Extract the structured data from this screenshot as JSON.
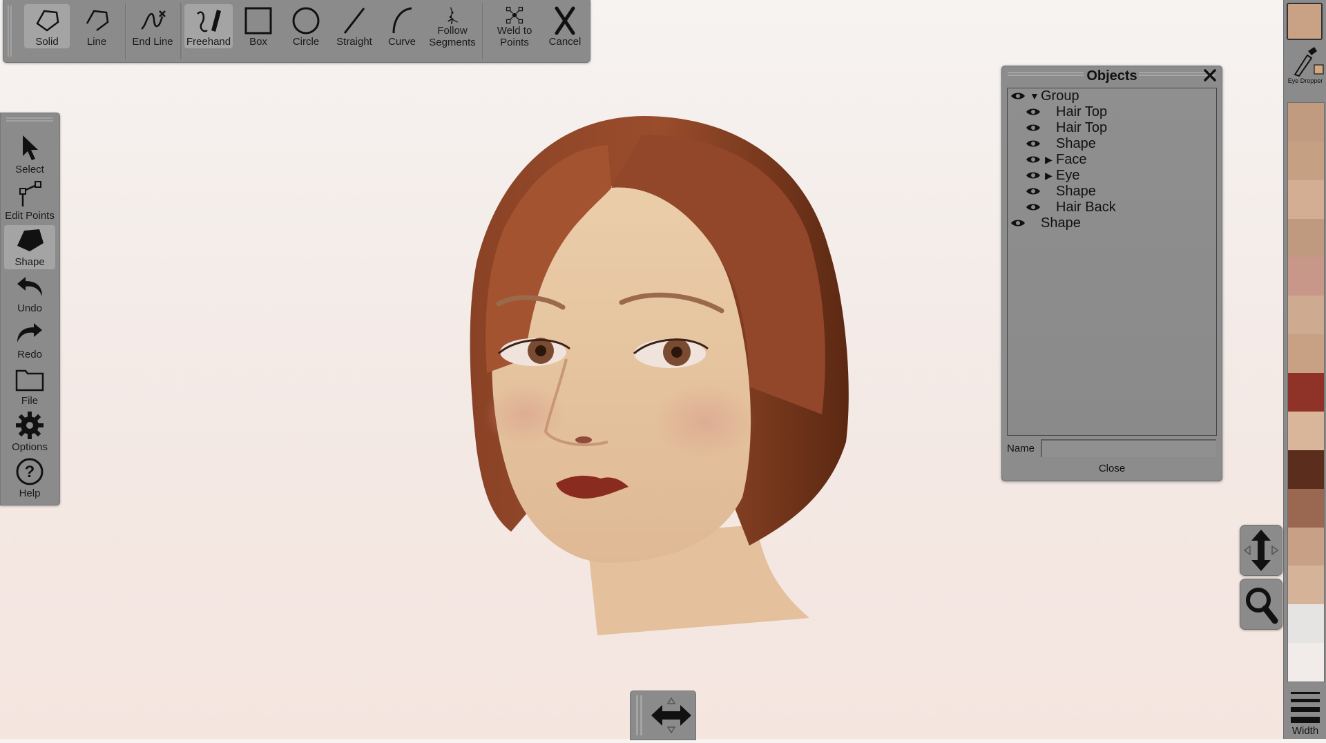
{
  "toolbar": {
    "tools": [
      {
        "label": "Solid",
        "icon": "solid-polygon-icon",
        "active": true
      },
      {
        "label": "Line",
        "icon": "line-polygon-icon",
        "active": false
      },
      {
        "label": "End Line",
        "icon": "end-line-icon",
        "active": false
      },
      {
        "label": "Freehand",
        "icon": "freehand-pencil-icon",
        "active": true
      },
      {
        "label": "Box",
        "icon": "box-icon",
        "active": false
      },
      {
        "label": "Circle",
        "icon": "circle-icon",
        "active": false
      },
      {
        "label": "Straight",
        "icon": "straight-line-icon",
        "active": false
      },
      {
        "label": "Curve",
        "icon": "curve-icon",
        "active": false
      },
      {
        "label": "Follow\nSegments",
        "icon": "follow-segments-icon",
        "active": false
      },
      {
        "label": "Weld to\nPoints",
        "icon": "weld-points-icon",
        "active": false
      },
      {
        "label": "Cancel",
        "icon": "cancel-x-icon",
        "active": false
      }
    ]
  },
  "sidebar": {
    "items": [
      {
        "label": "Select",
        "icon": "cursor-arrow-icon",
        "active": false
      },
      {
        "label": "Edit Points",
        "icon": "edit-points-icon",
        "active": false
      },
      {
        "label": "Shape",
        "icon": "shape-icon",
        "active": true
      },
      {
        "label": "Undo",
        "icon": "undo-arrow-icon",
        "active": false
      },
      {
        "label": "Redo",
        "icon": "redo-arrow-icon",
        "active": false
      },
      {
        "label": "File",
        "icon": "folder-icon",
        "active": false
      },
      {
        "label": "Options",
        "icon": "gear-icon",
        "active": false
      },
      {
        "label": "Help",
        "icon": "help-question-icon",
        "active": false
      }
    ]
  },
  "objects_panel": {
    "title": "Objects",
    "tree": [
      {
        "label": "Group",
        "depth": 0,
        "caret": "▼"
      },
      {
        "label": "Hair Top",
        "depth": 1,
        "caret": ""
      },
      {
        "label": "Hair Top",
        "depth": 1,
        "caret": ""
      },
      {
        "label": "Shape",
        "depth": 1,
        "caret": ""
      },
      {
        "label": "Face",
        "depth": 1,
        "caret": "▶"
      },
      {
        "label": "Eye",
        "depth": 1,
        "caret": "▶"
      },
      {
        "label": "Shape",
        "depth": 1,
        "caret": ""
      },
      {
        "label": "Hair Back",
        "depth": 1,
        "caret": ""
      },
      {
        "label": "Shape",
        "depth": 0,
        "caret": ""
      }
    ],
    "name_label": "Name",
    "name_value": "",
    "close_label": "Close"
  },
  "palette": {
    "current_color": "#c9a285",
    "eyedropper_label": "Eye Dropper",
    "width_label": "Width",
    "swatches": [
      "#c19b7f",
      "#c6a082",
      "#d3ae93",
      "#c09a7e",
      "#c9968a",
      "#ceaa90",
      "#c8a083",
      "#8f3328",
      "#d9b69a",
      "#5a2d1c",
      "#9a6850",
      "#c8a085",
      "#d4b398",
      "#e6e4e2",
      "#f1ece9"
    ]
  }
}
